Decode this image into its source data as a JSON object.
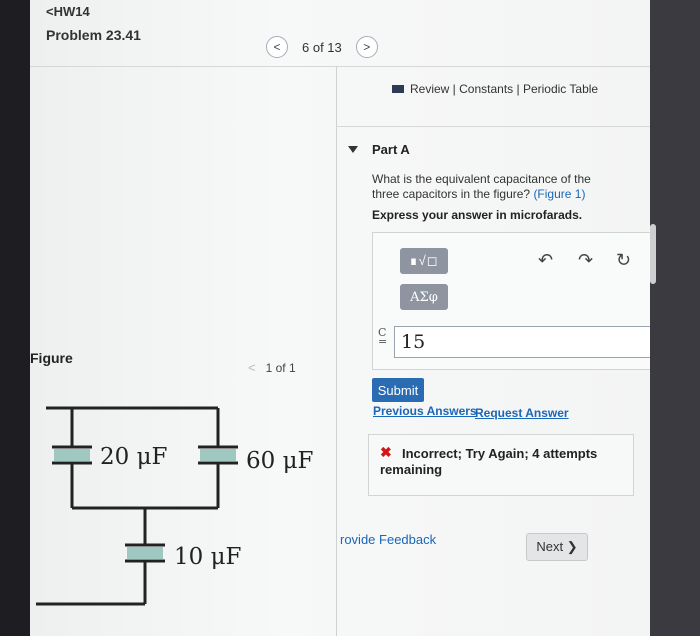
{
  "header": {
    "back_link": "<HW14",
    "problem_title": "Problem 23.41",
    "pager_text": "6 of 13",
    "prev_glyph": "<",
    "next_glyph": ">"
  },
  "resources": {
    "label": "Review | Constants | Periodic Table"
  },
  "part": {
    "label": "Part A",
    "question_text": "What is the equivalent capacitance of the three capacitors in the figure? ",
    "figure_link": "(Figure 1)",
    "instruction": "Express your answer in microfarads."
  },
  "answer": {
    "tool_matrix_label": "∎√◻",
    "tool_greek_label": "ΑΣφ",
    "variable_label_top": "C",
    "variable_label_bottom": "=",
    "value": "15"
  },
  "actions": {
    "submit_label": "Submit",
    "previous_answers_label": "Previous Answers",
    "request_answer_label": "Request Answer"
  },
  "feedback": {
    "status_icon": "✖",
    "message": "Incorrect; Try Again; 4 attempts remaining"
  },
  "footer": {
    "provide_feedback_label": "rovide Feedback",
    "next_label": "Next ❯"
  },
  "figure": {
    "title": "Figure",
    "pager_text": "1 of 1",
    "prev_glyph": "<",
    "capacitors": [
      {
        "label": "20 μF"
      },
      {
        "label": "60 μF"
      },
      {
        "label": "10 μF"
      }
    ]
  }
}
